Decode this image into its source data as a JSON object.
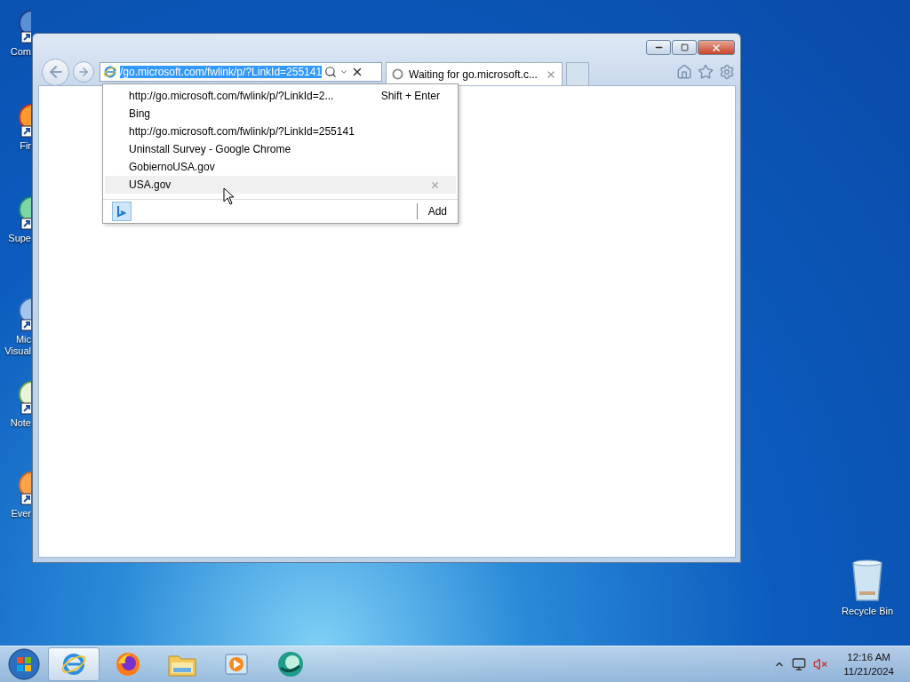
{
  "desktop_icons": [
    {
      "label": "Com",
      "kind": "computer"
    },
    {
      "label": "Fir",
      "kind": "firefox"
    },
    {
      "label": "Supe",
      "kind": "globe"
    },
    {
      "label": "Mic\nVisual",
      "kind": "studio"
    },
    {
      "label": "Note",
      "kind": "notepad"
    },
    {
      "label": "Ever",
      "kind": "everything"
    }
  ],
  "recycle_bin": {
    "label": "Recycle Bin"
  },
  "browser": {
    "address": {
      "text": "/go.microsoft.com/fwlink/p/?LinkId=255141",
      "highlighted": true
    },
    "tabs": [
      {
        "title": "Waiting for go.microsoft.c...",
        "selected": true,
        "loading": true
      }
    ],
    "suggestions": [
      {
        "text": "http://go.microsoft.com/fwlink/p/?LinkId=2...",
        "hint": "Shift + Enter",
        "selected": false
      },
      {
        "text": "Bing",
        "selected": false
      },
      {
        "text": "http://go.microsoft.com/fwlink/p/?LinkId=255141",
        "selected": false
      },
      {
        "text": "Uninstall Survey - Google Chrome",
        "selected": false
      },
      {
        "text": "GobiernoUSA.gov",
        "selected": false
      },
      {
        "text": "USA.gov",
        "selected": true
      }
    ],
    "add_label": "Add"
  },
  "taskbar": {
    "apps": [
      {
        "kind": "ie",
        "selected": true
      },
      {
        "kind": "firefox",
        "selected": false
      },
      {
        "kind": "folder",
        "selected": false
      },
      {
        "kind": "media",
        "selected": false
      },
      {
        "kind": "app",
        "selected": false
      }
    ],
    "time": "12:16 AM",
    "date": "11/21/2024"
  }
}
